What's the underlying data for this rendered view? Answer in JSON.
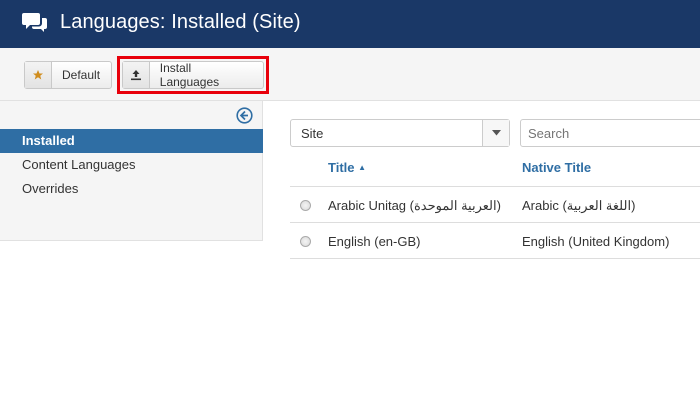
{
  "header": {
    "title": "Languages: Installed (Site)",
    "icon": "speech-bubbles-icon"
  },
  "toolbar": {
    "default_label": "Default",
    "default_icon": "star-icon",
    "install_label": "Install Languages",
    "install_icon": "upload-icon"
  },
  "sidebar": {
    "items": [
      {
        "label": "Installed",
        "active": true
      },
      {
        "label": "Content Languages",
        "active": false
      },
      {
        "label": "Overrides",
        "active": false
      }
    ]
  },
  "filters": {
    "client_select": "Site",
    "search_placeholder": "Search"
  },
  "table": {
    "columns": [
      "Title",
      "Native Title"
    ],
    "sort_indicator": "▲",
    "rows": [
      {
        "title": "Arabic Unitag (العربية الموحدة)",
        "native": "Arabic (اللغة العربية)"
      },
      {
        "title": "English (en-GB)",
        "native": "English (United Kingdom)"
      }
    ]
  },
  "colors": {
    "header_bg": "#1a3867",
    "active_bg": "#2f6ea4",
    "highlight": "#e8000b",
    "star": "#d08d1e"
  }
}
